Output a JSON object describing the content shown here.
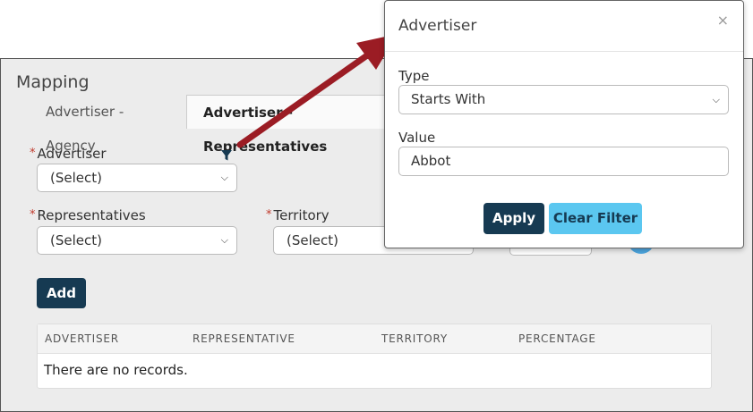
{
  "panel": {
    "title": "Mapping"
  },
  "tabs": [
    {
      "label": "Advertiser - Agency"
    },
    {
      "label": "Advertiser - Representatives"
    }
  ],
  "form": {
    "advertiser": {
      "label": "Advertiser",
      "value": "(Select)",
      "required": "*"
    },
    "representatives": {
      "label": "Representatives",
      "value": "(Select)",
      "required": "*"
    },
    "territory": {
      "label": "Territory",
      "value": "(Select)",
      "required": "*"
    },
    "add_label": "Add"
  },
  "grid": {
    "columns": [
      "ADVERTISER",
      "REPRESENTATIVE",
      "TERRITORY",
      "PERCENTAGE"
    ],
    "empty_text": "There are no records."
  },
  "popover": {
    "title": "Advertiser",
    "close_icon": "×",
    "type_label": "Type",
    "type_value": "Starts With",
    "value_label": "Value",
    "value_value": "Abbot",
    "apply_label": "Apply",
    "clear_label": "Clear Filter"
  },
  "colors": {
    "primary": "#163a52",
    "accent": "#5bc7f0",
    "arrow": "#9b1c24",
    "required": "#c0392b"
  },
  "icons": {
    "filter": "filter-icon",
    "chevron": "chevron-down-icon"
  }
}
